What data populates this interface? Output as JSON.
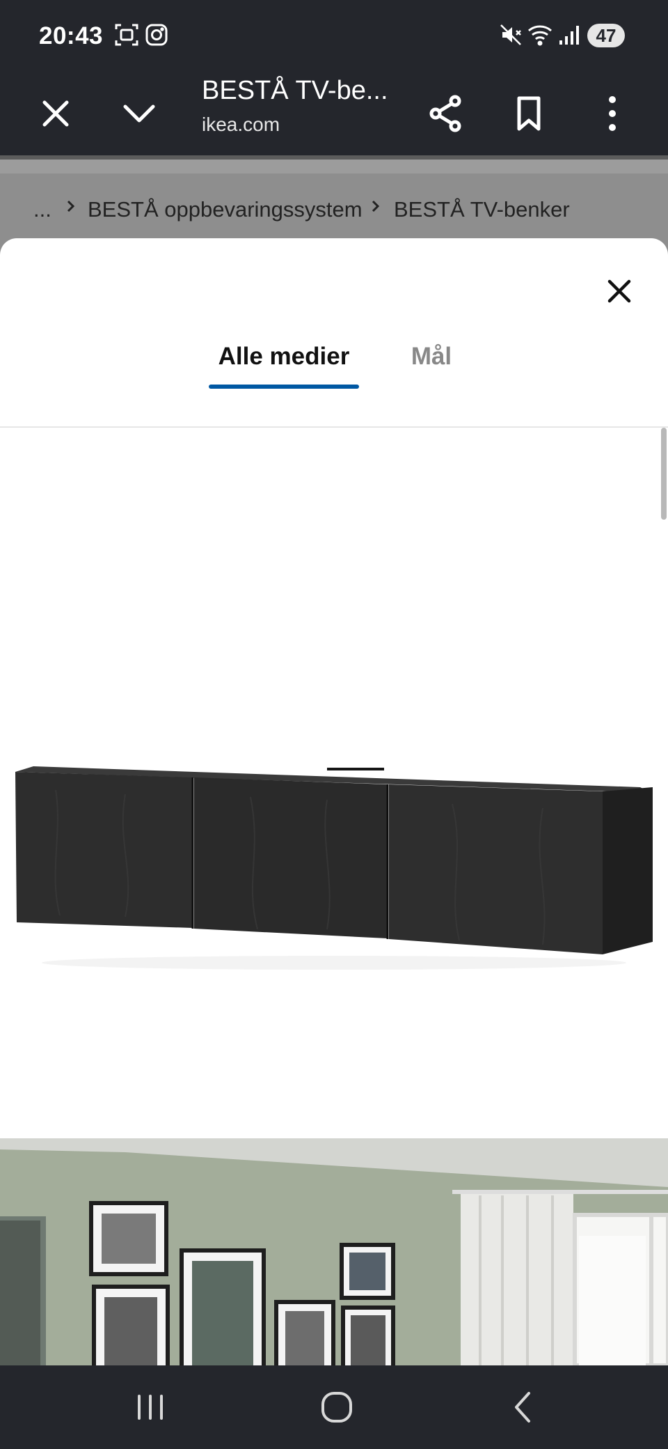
{
  "status_bar": {
    "time": "20:43",
    "battery": "47",
    "icons": [
      "screenshot-icon",
      "instagram-icon",
      "mute-icon",
      "wifi-icon",
      "signal-icon"
    ]
  },
  "browser": {
    "title": "BESTÅ TV-be...",
    "domain": "ikea.com",
    "icons": [
      "close-icon",
      "chevron-down-icon",
      "share-icon",
      "bookmark-icon",
      "more-icon"
    ]
  },
  "breadcrumb": {
    "ellipsis": "...",
    "item1": "BESTÅ oppbevaringssystem",
    "item2": "BESTÅ TV-benker"
  },
  "modal": {
    "tabs": [
      {
        "label": "Alle medier",
        "active": true
      },
      {
        "label": "Mål",
        "active": false
      }
    ]
  },
  "colors": {
    "system_bar": "#24262c",
    "accent": "#0058a3",
    "wall": "#a3ad9a"
  },
  "nav": {
    "icons": [
      "recent-apps-icon",
      "home-icon",
      "back-icon"
    ]
  }
}
